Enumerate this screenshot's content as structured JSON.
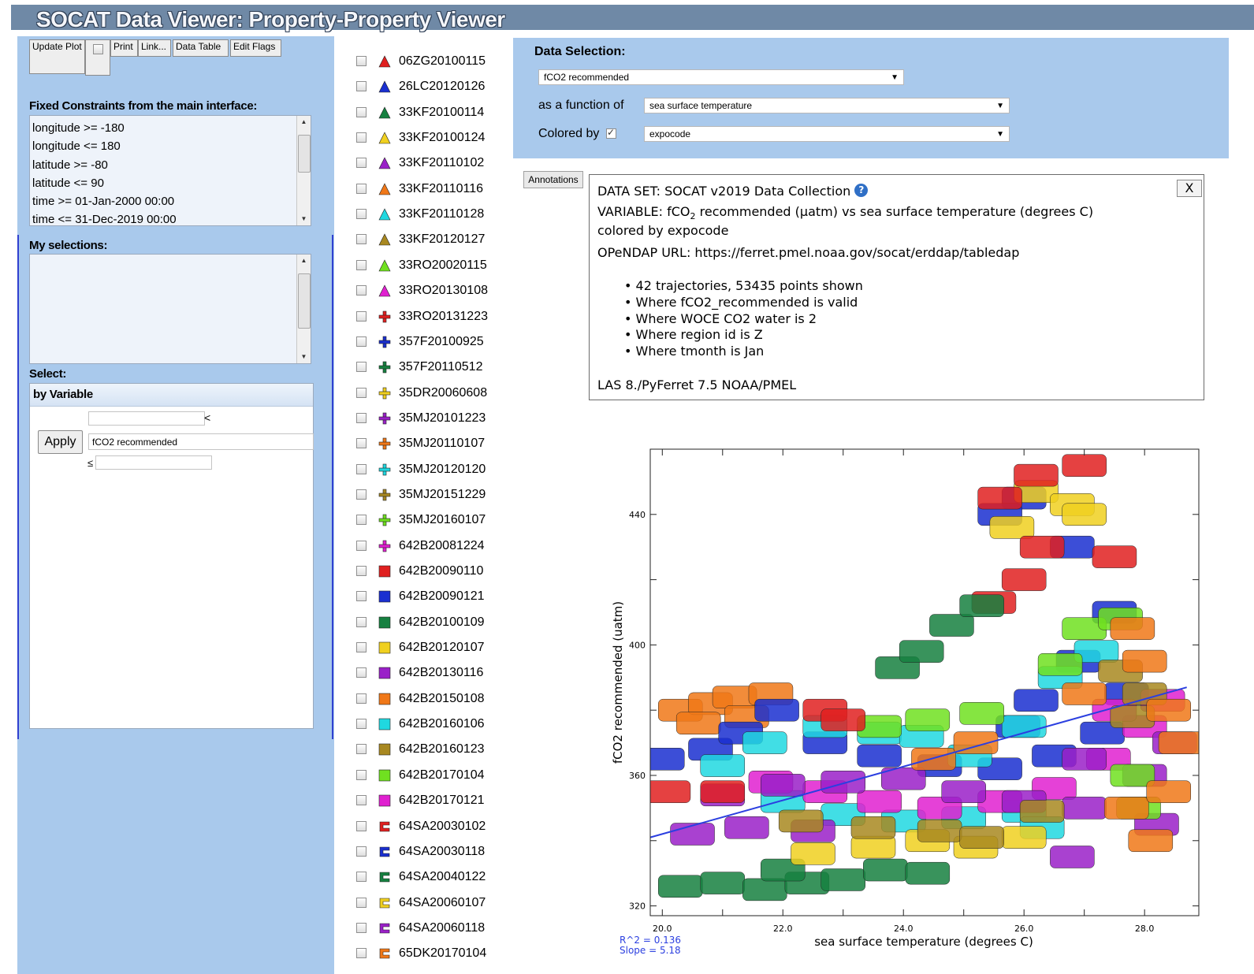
{
  "app": {
    "title": "SOCAT Data Viewer: Property-Property Viewer"
  },
  "toolbar": {
    "update_plot": "Update Plot",
    "print": "Print",
    "link": "Link...",
    "data_table": "Data Table",
    "edit_flags": "Edit Flags"
  },
  "fixed_constraints": {
    "heading": "Fixed Constraints from the main interface:",
    "items": [
      "longitude >= -180",
      "longitude <= 180",
      "latitude >= -80",
      "latitude <= 90",
      "time >= 01-Jan-2000 00:00",
      "time <= 31-Dec-2019 00:00"
    ]
  },
  "my_selections": {
    "heading": "My selections:"
  },
  "select": {
    "heading": "Select:",
    "tab": "by Variable",
    "apply": "Apply",
    "variable": "fCO2 recommended",
    "lt_symbol": "<",
    "le_symbol": "≤",
    "lower_value": "",
    "upper_value": ""
  },
  "legend": [
    {
      "code": "06ZG20100115",
      "shape": "triangle",
      "color": "#e02020"
    },
    {
      "code": "26LC20120126",
      "shape": "triangle",
      "color": "#1a2fd0"
    },
    {
      "code": "33KF20100114",
      "shape": "triangle",
      "color": "#168040"
    },
    {
      "code": "33KF20100124",
      "shape": "triangle",
      "color": "#f0d020"
    },
    {
      "code": "33KF20110102",
      "shape": "triangle",
      "color": "#9a20c8"
    },
    {
      "code": "33KF20110116",
      "shape": "triangle",
      "color": "#f07818"
    },
    {
      "code": "33KF20110128",
      "shape": "triangle",
      "color": "#20d8e0"
    },
    {
      "code": "33KF20120127",
      "shape": "triangle",
      "color": "#a88820"
    },
    {
      "code": "33RO20020115",
      "shape": "triangle",
      "color": "#70e020"
    },
    {
      "code": "33RO20130108",
      "shape": "triangle",
      "color": "#e020d0"
    },
    {
      "code": "33RO20131223",
      "shape": "plus",
      "color": "#e02020"
    },
    {
      "code": "357F20100925",
      "shape": "plus",
      "color": "#1a2fd0"
    },
    {
      "code": "357F20110512",
      "shape": "plus",
      "color": "#168040"
    },
    {
      "code": "35DR20060608",
      "shape": "plus",
      "color": "#f0d020"
    },
    {
      "code": "35MJ20101223",
      "shape": "plus",
      "color": "#9a20c8"
    },
    {
      "code": "35MJ20110107",
      "shape": "plus",
      "color": "#f07818"
    },
    {
      "code": "35MJ20120120",
      "shape": "plus",
      "color": "#20d8e0"
    },
    {
      "code": "35MJ20151229",
      "shape": "plus",
      "color": "#a88820"
    },
    {
      "code": "35MJ20160107",
      "shape": "plus",
      "color": "#70e020"
    },
    {
      "code": "642B20081224",
      "shape": "plus",
      "color": "#e020d0"
    },
    {
      "code": "642B20090110",
      "shape": "square",
      "color": "#e02020"
    },
    {
      "code": "642B20090121",
      "shape": "square",
      "color": "#1a2fd0"
    },
    {
      "code": "642B20100109",
      "shape": "square",
      "color": "#168040"
    },
    {
      "code": "642B20120107",
      "shape": "square",
      "color": "#f0d020"
    },
    {
      "code": "642B20130116",
      "shape": "square",
      "color": "#9a20c8"
    },
    {
      "code": "642B20150108",
      "shape": "square",
      "color": "#f07818"
    },
    {
      "code": "642B20160106",
      "shape": "square",
      "color": "#20d8e0"
    },
    {
      "code": "642B20160123",
      "shape": "square",
      "color": "#a88820"
    },
    {
      "code": "642B20170104",
      "shape": "square",
      "color": "#70e020"
    },
    {
      "code": "642B20170121",
      "shape": "square",
      "color": "#e020d0"
    },
    {
      "code": "64SA20030102",
      "shape": "bracket",
      "color": "#e02020"
    },
    {
      "code": "64SA20030118",
      "shape": "bracket",
      "color": "#1a2fd0"
    },
    {
      "code": "64SA20040122",
      "shape": "bracket",
      "color": "#168040"
    },
    {
      "code": "64SA20060107",
      "shape": "bracket",
      "color": "#f0d020"
    },
    {
      "code": "64SA20060118",
      "shape": "bracket",
      "color": "#9a20c8"
    },
    {
      "code": "65DK20170104",
      "shape": "bracket",
      "color": "#f07818"
    }
  ],
  "data_selection": {
    "heading": "Data Selection:",
    "y_variable": "fCO2 recommended",
    "function_label": "as a function of",
    "x_variable": "sea surface temperature",
    "colored_label": "Colored by",
    "color_variable": "expocode"
  },
  "annotations": {
    "tab": "Annotations",
    "close": "X",
    "dataset_prefix": "DATA SET: ",
    "dataset": "SOCAT v2019 Data Collection",
    "variable_pre": "VARIABLE: fCO",
    "variable_sub": "2",
    "variable_post": " recommended (µatm) vs sea surface temperature (degrees C)",
    "colored_by": "colored by expocode",
    "opendap": "OPeNDAP URL: https://ferret.pmel.noaa.gov/socat/erddap/tabledap",
    "bullets": [
      "42 trajectories, 53435 points shown",
      "Where fCO2_recommended is valid",
      "Where WOCE CO2 water is 2",
      "Where region id is Z",
      "Where tmonth is Jan"
    ],
    "footer": "LAS 8./PyFerret 7.5 NOAA/PMEL"
  },
  "chart_data": {
    "type": "scatter",
    "xlabel": "sea surface temperature (degrees C)",
    "ylabel": "fCO2 recommended (uatm)",
    "xlim": [
      19.8,
      28.9
    ],
    "ylim": [
      317,
      460
    ],
    "x_ticks": [
      "20.0",
      "22.0",
      "24.0",
      "26.0",
      "28.0"
    ],
    "y_ticks": [
      "320",
      "360",
      "400",
      "440"
    ],
    "regression": {
      "x": [
        19.8,
        28.7
      ],
      "y": [
        341,
        387
      ]
    },
    "stats": [
      "R^2 = 0.136",
      "Slope = 5.18"
    ],
    "clusters": [
      {
        "color": "#f07818",
        "pts": [
          [
            20.3,
            380
          ],
          [
            20.8,
            382
          ],
          [
            21.2,
            384
          ],
          [
            21.8,
            385
          ],
          [
            21.4,
            378
          ],
          [
            20.6,
            376
          ]
        ]
      },
      {
        "color": "#168040",
        "pts": [
          [
            20.3,
            326
          ],
          [
            21.0,
            327
          ],
          [
            21.7,
            325
          ],
          [
            22.4,
            327
          ],
          [
            23.0,
            328
          ],
          [
            23.7,
            331
          ],
          [
            24.4,
            330
          ],
          [
            22.0,
            331
          ]
        ]
      },
      {
        "color": "#1a2fd0",
        "pts": [
          [
            20.0,
            365
          ],
          [
            20.8,
            368
          ],
          [
            21.3,
            373
          ],
          [
            21.9,
            380
          ],
          [
            22.7,
            370
          ],
          [
            23.6,
            366
          ],
          [
            24.6,
            363
          ],
          [
            25.6,
            362
          ],
          [
            26.5,
            366
          ],
          [
            27.3,
            373
          ],
          [
            27.7,
            385
          ],
          [
            26.9,
            395
          ],
          [
            27.5,
            410
          ],
          [
            26.8,
            430
          ],
          [
            26.0,
            445
          ],
          [
            25.6,
            440
          ],
          [
            25.9,
            375
          ],
          [
            26.2,
            383
          ]
        ]
      },
      {
        "color": "#20d8e0",
        "pts": [
          [
            21.0,
            363
          ],
          [
            21.7,
            370
          ],
          [
            22.7,
            375
          ],
          [
            23.6,
            373
          ],
          [
            24.3,
            372
          ],
          [
            25.1,
            366
          ],
          [
            26.0,
            375
          ],
          [
            26.6,
            390
          ],
          [
            27.2,
            398
          ],
          [
            22.0,
            352
          ],
          [
            23.0,
            348
          ],
          [
            24.0,
            346
          ],
          [
            25.0,
            347
          ],
          [
            26.0,
            349
          ],
          [
            26.3,
            344
          ]
        ]
      },
      {
        "color": "#e020d0",
        "pts": [
          [
            21.8,
            358
          ],
          [
            22.7,
            355
          ],
          [
            23.6,
            352
          ],
          [
            24.6,
            350
          ],
          [
            25.6,
            352
          ],
          [
            26.5,
            356
          ],
          [
            27.4,
            365
          ],
          [
            28.0,
            375
          ],
          [
            27.5,
            380
          ],
          [
            28.3,
            383
          ]
        ]
      },
      {
        "color": "#9a20c8",
        "pts": [
          [
            21.0,
            354
          ],
          [
            22.0,
            357
          ],
          [
            23.0,
            358
          ],
          [
            24.0,
            359
          ],
          [
            25.0,
            355
          ],
          [
            26.0,
            352
          ],
          [
            27.0,
            350
          ],
          [
            28.0,
            360
          ],
          [
            28.5,
            370
          ],
          [
            28.2,
            345
          ],
          [
            27.0,
            365
          ],
          [
            20.5,
            342
          ],
          [
            21.4,
            344
          ],
          [
            22.5,
            343
          ],
          [
            26.8,
            335
          ]
        ]
      },
      {
        "color": "#f0d020",
        "pts": [
          [
            22.5,
            336
          ],
          [
            23.5,
            338
          ],
          [
            24.4,
            340
          ],
          [
            25.2,
            338
          ],
          [
            26.0,
            341
          ],
          [
            26.2,
            447
          ],
          [
            26.8,
            443
          ],
          [
            27.0,
            440
          ],
          [
            25.8,
            436
          ]
        ]
      },
      {
        "color": "#70e020",
        "pts": [
          [
            23.6,
            375
          ],
          [
            24.4,
            377
          ],
          [
            25.3,
            379
          ],
          [
            26.6,
            394
          ],
          [
            27.0,
            405
          ],
          [
            27.6,
            408
          ],
          [
            27.8,
            360
          ],
          [
            27.9,
            350
          ]
        ]
      },
      {
        "color": "#e02020",
        "pts": [
          [
            20.1,
            355
          ],
          [
            21.0,
            355
          ],
          [
            22.7,
            380
          ],
          [
            23.0,
            377
          ],
          [
            25.6,
            445
          ],
          [
            26.2,
            452
          ],
          [
            27.0,
            455
          ],
          [
            26.3,
            430
          ],
          [
            27.5,
            427
          ],
          [
            25.5,
            413
          ],
          [
            26.0,
            420
          ]
        ]
      },
      {
        "color": "#a88820",
        "pts": [
          [
            22.3,
            346
          ],
          [
            23.5,
            344
          ],
          [
            24.6,
            343
          ],
          [
            25.3,
            341
          ],
          [
            26.3,
            349
          ],
          [
            27.8,
            378
          ],
          [
            28.0,
            385
          ],
          [
            27.6,
            392
          ]
        ]
      },
      {
        "color": "#f07818",
        "pts": [
          [
            24.5,
            365
          ],
          [
            25.2,
            370
          ],
          [
            27.0,
            385
          ],
          [
            27.8,
            405
          ],
          [
            28.0,
            395
          ],
          [
            28.4,
            380
          ],
          [
            28.6,
            370
          ],
          [
            27.7,
            350
          ],
          [
            28.1,
            340
          ],
          [
            28.4,
            355
          ]
        ]
      },
      {
        "color": "#168040",
        "pts": [
          [
            23.9,
            393
          ],
          [
            24.3,
            398
          ],
          [
            24.8,
            406
          ],
          [
            25.3,
            412
          ]
        ]
      }
    ]
  }
}
